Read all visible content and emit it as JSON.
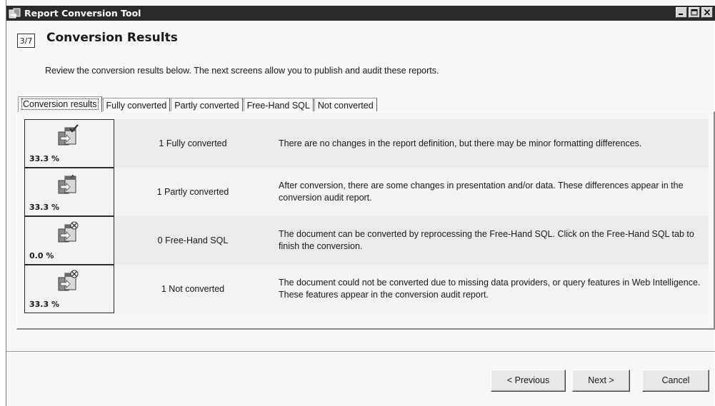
{
  "window": {
    "title": "Report Conversion Tool",
    "icon": "report-conversion-app-icon",
    "controls": [
      "minimize-icon",
      "maximize-icon",
      "close-icon"
    ]
  },
  "header": {
    "step": "3/7",
    "title": "Conversion Results",
    "description": "Review the conversion results below. The next screens allow you to publish and audit these reports."
  },
  "tabs": [
    {
      "label": "Conversion results",
      "active": true
    },
    {
      "label": "Fully converted",
      "active": false
    },
    {
      "label": "Partly converted",
      "active": false
    },
    {
      "label": "Free-Hand SQL",
      "active": false
    },
    {
      "label": "Not converted",
      "active": false
    }
  ],
  "results": [
    {
      "percent": "33.3 %",
      "label": "1 Fully converted",
      "description": "There are no changes in the report definition, but there may be minor formatting differences.",
      "icon": "document-converted-check-icon"
    },
    {
      "percent": "33.3 %",
      "label": "1 Partly converted",
      "description": "After conversion, there are some changes in presentation and/or data. These differences appear in the conversion audit report.",
      "icon": "document-partly-converted-icon"
    },
    {
      "percent": "0.0 %",
      "label": "0 Free-Hand SQL",
      "description": "The document can be converted by reprocessing the Free-Hand SQL. Click on the Free-Hand SQL tab to finish the conversion.",
      "icon": "document-freehand-sql-icon"
    },
    {
      "percent": "33.3 %",
      "label": "1 Not converted",
      "description": "The document could not be converted due to missing data providers, or query features in Web Intelligence. These features appear in the conversion audit report.",
      "icon": "document-not-converted-icon"
    }
  ],
  "buttons": {
    "previous": "< Previous",
    "next": "Next >",
    "cancel": "Cancel"
  }
}
